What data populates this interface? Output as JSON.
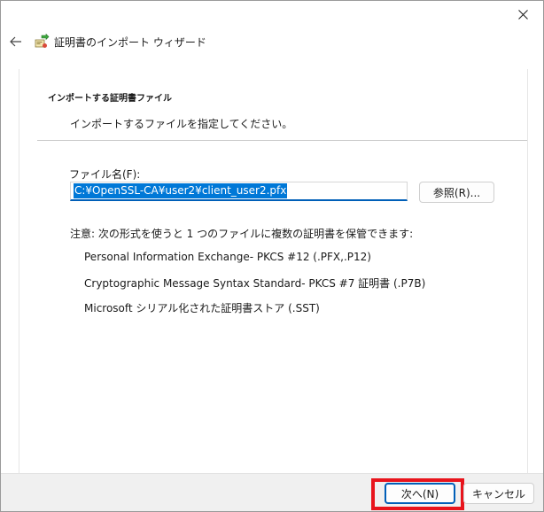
{
  "wizard": {
    "title": "証明書のインポート ウィザード",
    "icons": {
      "back": "back-arrow-icon",
      "close": "close-icon",
      "wizard": "certificate-import-icon"
    }
  },
  "page": {
    "heading": "インポートする証明書ファイル",
    "description": "インポートするファイルを指定してください。"
  },
  "file": {
    "label": "ファイル名(F):",
    "value": "C:¥OpenSSL-CA¥user2¥client_user2.pfx",
    "browse_label": "参照(R)..."
  },
  "note": {
    "text": "注意: 次の形式を使うと 1 つのファイルに複数の証明書を保管できます:",
    "formats": [
      "Personal Information Exchange- PKCS #12 (.PFX,.P12)",
      "Cryptographic Message Syntax Standard- PKCS #7 証明書 (.P7B)",
      "Microsoft シリアル化された証明書ストア (.SST)"
    ]
  },
  "footer": {
    "next_label": "次へ(N)",
    "cancel_label": "キャンセル"
  },
  "colors": {
    "accent": "#005fb8",
    "selection": "#0078d7",
    "highlight": "#e8141c",
    "footer_bg": "#f0f0f0"
  }
}
